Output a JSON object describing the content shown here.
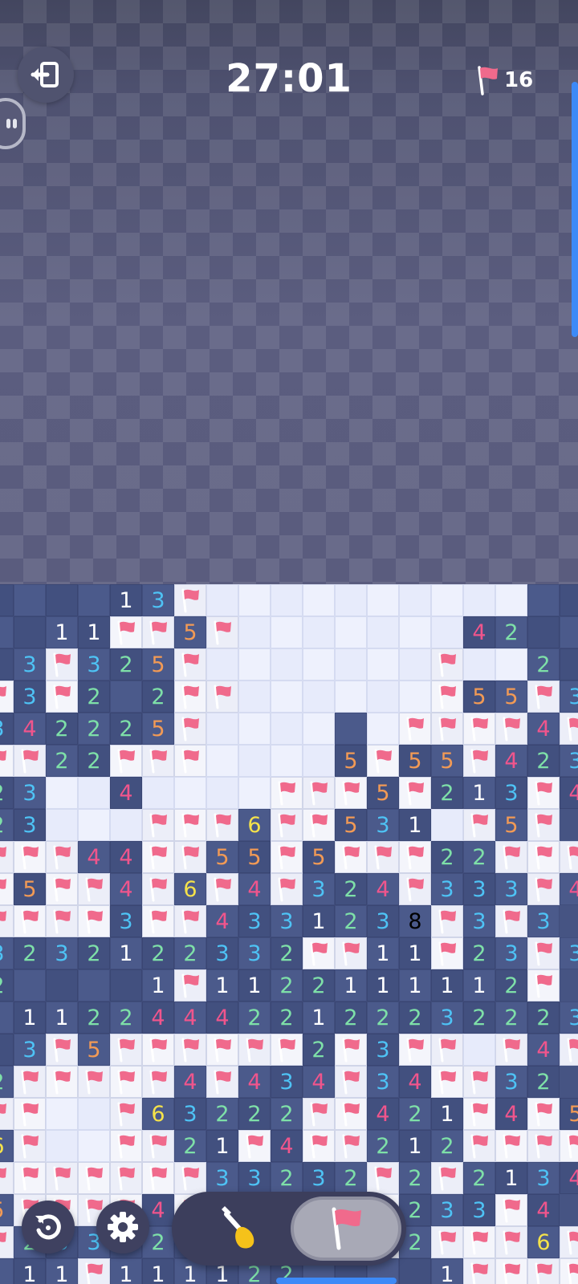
{
  "header": {
    "timer": "27:01",
    "flags_remaining": "16",
    "exit_icon": "exit-icon",
    "flag_icon": "flag-icon"
  },
  "colors": {
    "flag": "#f06a8c",
    "accent": "#3d8af7",
    "n1": "#ffffff",
    "n2": "#7ee0a8",
    "n3": "#4ec3f5",
    "n4": "#f0558c",
    "n5": "#f29a55",
    "n6": "#f5e24a"
  },
  "board": {
    "legend": "h = hidden tile, o = opened empty tile, F = flagged tile, digits = opened number tile",
    "rows": [
      "hhhh13Foooooooooohh",
      "hh11FF5Fooooooo42hh",
      "h3F325Foooooo F  2h",
      "F3F2h2FFooooooF55F3",
      "342225Fooooh FFFF4F3",
      "FF22FFFoooo5F55F423F",
      "23oo4ooooFFF5F213F4F",
      "23oooFFF6FF531oF5F",
      "FFF44FF55F5FFF22FFF",
      "F5FF4F6F4F324F333F4F",
      "FFFF3FF4331238F3F3",
      "3232122332FF11F23F3",
      "2hhhh1F1122111112F",
      "h1122444221222322233",
      "h3F5FFFFFF2F3FF F4F2",
      "2FFFFF4F434F34FF32",
      "FFooF63222FF421F4F52",
      "6FooFF21F4FF212FFFF",
      "FFFFFFF33232F2F21345",
      "5FFFF4FFFFF4F233F4",
      "F2333232FFFFF2FFF6F",
      "h11F111122hhhh1FFFF"
    ]
  },
  "controls": {
    "restart_icon": "restart-icon",
    "settings_icon": "gear-icon",
    "dig_mode_icon": "shovel-icon",
    "flag_mode_icon": "flag-icon",
    "active_mode": "flag"
  }
}
